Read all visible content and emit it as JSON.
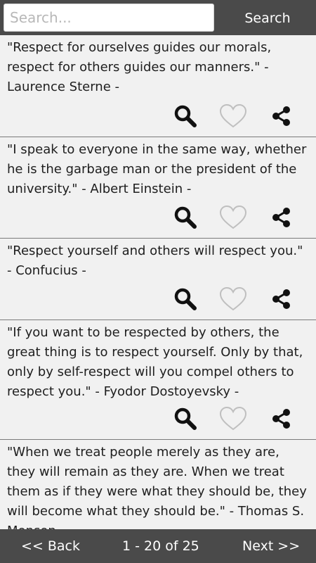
{
  "search": {
    "placeholder": "Search...",
    "button_label": "Search"
  },
  "quotes": [
    {
      "text": "\"Respect for ourselves guides our morals, respect for others guides our manners.\" - Laurence Sterne -"
    },
    {
      "text": "\"I speak to everyone in the same way, whether he is the garbage man or the president of the university.\" - Albert Einstein -"
    },
    {
      "text": "\"Respect yourself and others will respect you.\" - Confucius -"
    },
    {
      "text": "\"If you want to be respected by others, the great thing is to respect yourself. Only by that, only by self-respect will you compel others to respect you.\" - Fyodor Dostoyevsky -"
    },
    {
      "text": "\"When we treat people merely as they are, they will remain as they are. When we treat them as if they were what they should be, they will become what they should be.\" - Thomas S. Monson -"
    }
  ],
  "pagination": {
    "back_label": "<< Back",
    "range_label": "1 - 20 of 25",
    "next_label": "Next >>"
  },
  "icons": {
    "search": "magnifier-icon",
    "favorite": "heart-outline-icon",
    "share": "share-icon"
  },
  "colors": {
    "bar": "#4a4a4a",
    "background": "#f1f1f1",
    "text": "#1e1e1e"
  }
}
